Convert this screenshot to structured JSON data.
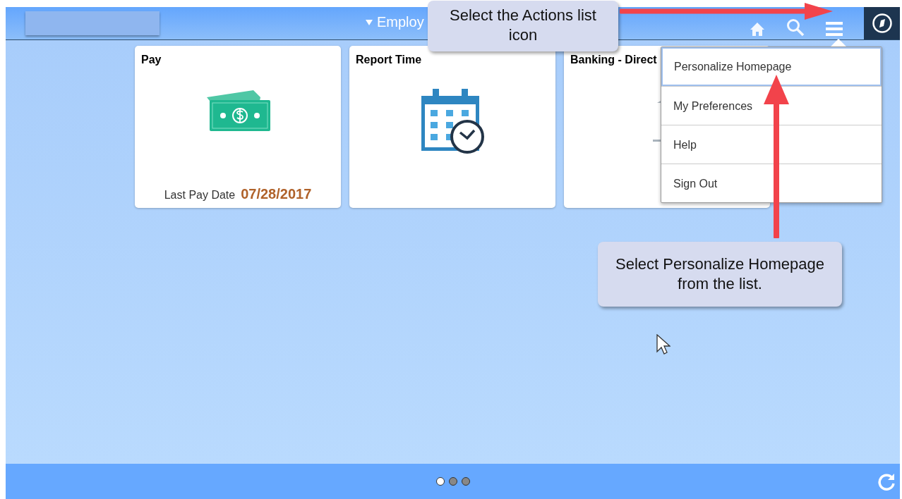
{
  "header": {
    "title": "Employ"
  },
  "tiles": [
    {
      "kind": "pay",
      "title": "Pay",
      "footer_label": "Last Pay Date",
      "footer_value": "07/28/2017"
    },
    {
      "kind": "time",
      "title": "Report Time"
    },
    {
      "kind": "bank",
      "title": "Banking - Direct"
    }
  ],
  "actions_menu": {
    "items": [
      {
        "label": "Personalize Homepage",
        "selected": true
      },
      {
        "label": "My Preferences",
        "selected": false
      },
      {
        "label": "Help",
        "selected": false
      },
      {
        "label": "Sign Out",
        "selected": false
      }
    ]
  },
  "callouts": [
    {
      "text": "Select the Actions list icon"
    },
    {
      "text": "Select Personalize Homepage from the list."
    }
  ],
  "pager": [
    {
      "selected": true
    },
    {
      "selected": false
    },
    {
      "selected": false
    }
  ]
}
